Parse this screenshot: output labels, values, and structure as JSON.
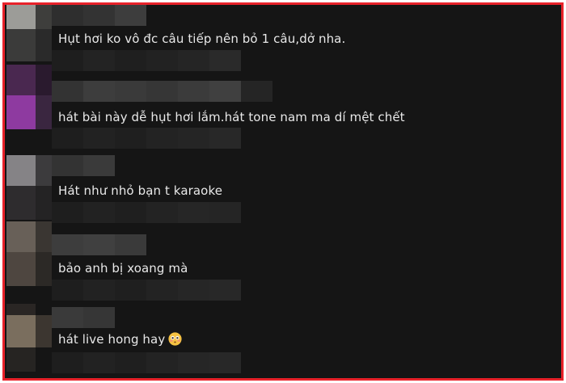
{
  "comments": [
    {
      "text": "Hụt hơi ko vô đc câu tiếp nên bỏ 1 câu,dở nha."
    },
    {
      "text": "hát bài này dễ hụt hơi lắm.hát tone nam ma dí mệt chết"
    },
    {
      "text": "Hát như nhỏ bạn t karaoke"
    },
    {
      "text": "bảo anh bị xoang mà"
    },
    {
      "text": "hát live hong hay",
      "emoji": "flushed-face"
    }
  ],
  "colors": {
    "frame_border": "#e8222a",
    "background": "#151515",
    "text": "#e8e8e8"
  }
}
